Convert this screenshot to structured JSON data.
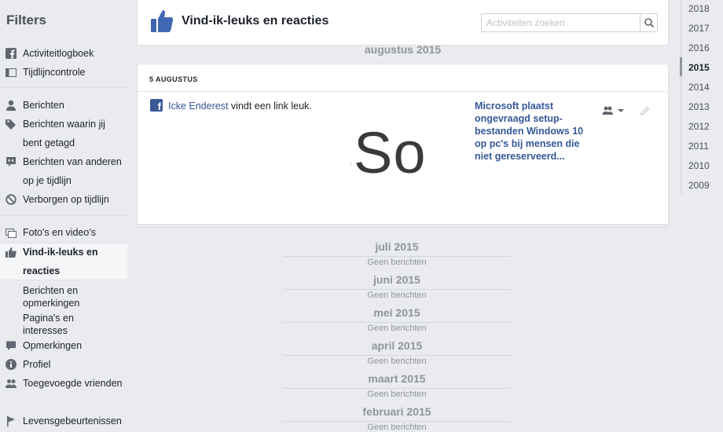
{
  "sidebar": {
    "title": "Filters",
    "items": [
      {
        "label": "Activiteitlogboek"
      },
      {
        "label": "Tijdlijncontrole"
      },
      {
        "label": "Berichten"
      },
      {
        "label": "Berichten waarin jij bent getagd"
      },
      {
        "label": "Berichten van anderen op je tijdlijn"
      },
      {
        "label": "Verborgen op tijdlijn"
      },
      {
        "label": "Foto's en video's"
      },
      {
        "label": "Vind-ik-leuks en reacties"
      },
      {
        "label": "Berichten en opmerkingen"
      },
      {
        "label": "Pagina's en interesses"
      },
      {
        "label": "Opmerkingen"
      },
      {
        "label": "Profiel"
      },
      {
        "label": "Toegevoegde vrienden"
      },
      {
        "label": "Levensgebeurtenissen"
      }
    ]
  },
  "header": {
    "title": "Vind-ik-leuks en reacties",
    "search_placeholder": "Activiteiten zoeken"
  },
  "timeline": {
    "month_heading": "augustus 2015",
    "post": {
      "date": "5 AUGUSTUS",
      "actor": "Icke Enderest",
      "action": " vindt een link leuk.",
      "thumbnail_text": "sSo",
      "link_title": "Microsoft plaatst ongevraagd setup-bestanden Windows 10 op pc's bij mensen die niet gereserveerd..."
    },
    "empty_months": [
      {
        "month": "juli 2015",
        "note": "Geen berichten"
      },
      {
        "month": "juni 2015",
        "note": "Geen berichten"
      },
      {
        "month": "mei 2015",
        "note": "Geen berichten"
      },
      {
        "month": "april 2015",
        "note": "Geen berichten"
      },
      {
        "month": "maart 2015",
        "note": "Geen berichten"
      },
      {
        "month": "februari 2015",
        "note": "Geen berichten"
      }
    ]
  },
  "years": [
    "2018",
    "2017",
    "2016",
    "2015",
    "2014",
    "2013",
    "2012",
    "2011",
    "2010",
    "2009"
  ],
  "active_year": "2015",
  "colors": {
    "brand": "#3b5998",
    "link": "#365899",
    "muted": "#90949c",
    "background": "#e9ebee"
  }
}
